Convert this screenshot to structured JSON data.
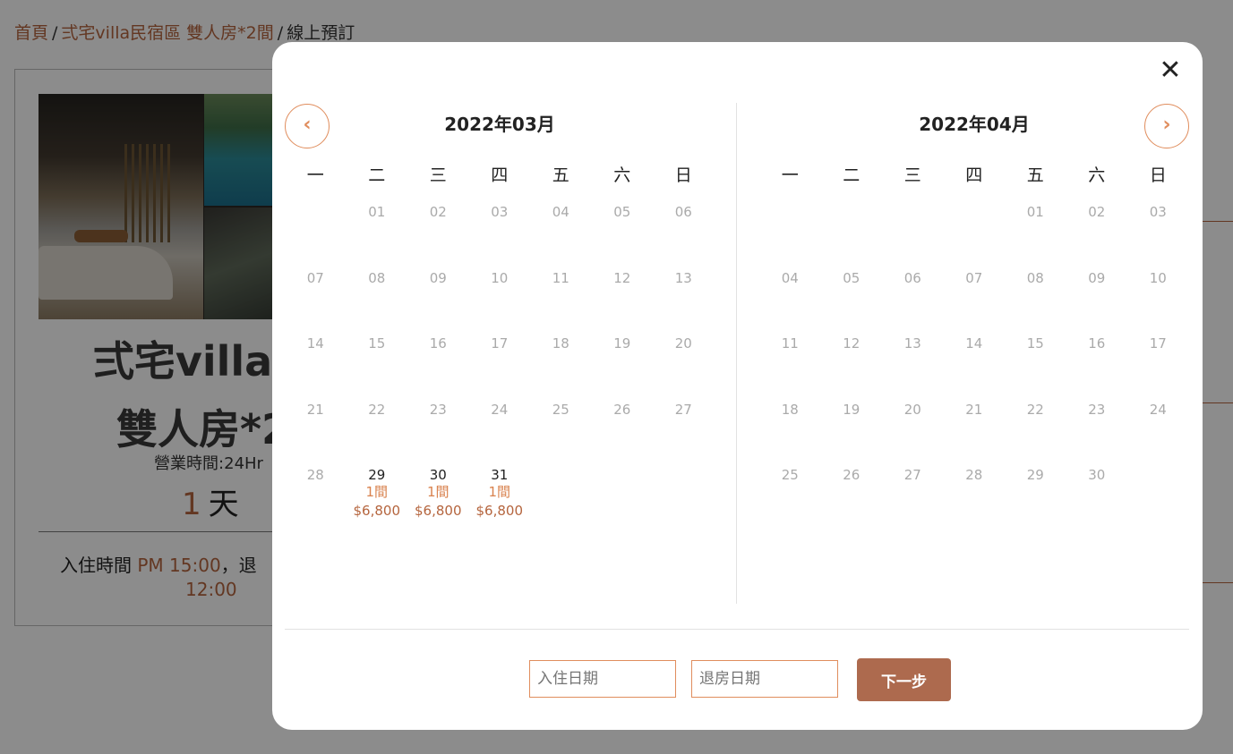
{
  "breadcrumb": {
    "home": "首頁",
    "property": "弍宅villa民宿區 雙人房*2間",
    "current": "線上預訂",
    "separator": "/"
  },
  "card": {
    "title_line1": "弍宅villa民",
    "title_line2": "雙人房*2",
    "hours": "營業時間:24Hr",
    "days_num": "1",
    "days_unit": "天",
    "checkin_label": "入住時間",
    "checkin_time": "PM 15:00",
    "checkout_partial": "，退",
    "checkout_time": "12:00"
  },
  "modal": {
    "close_glyph": "✕",
    "prev_glyph": "‹",
    "next_glyph": "›",
    "weekdays": [
      "一",
      "二",
      "三",
      "四",
      "五",
      "六",
      "日"
    ],
    "months": [
      {
        "title": "2022年03月",
        "leading_blanks": 1,
        "days": [
          {
            "d": "01"
          },
          {
            "d": "02"
          },
          {
            "d": "03"
          },
          {
            "d": "04"
          },
          {
            "d": "05"
          },
          {
            "d": "06"
          },
          {
            "d": "07"
          },
          {
            "d": "08"
          },
          {
            "d": "09"
          },
          {
            "d": "10"
          },
          {
            "d": "11"
          },
          {
            "d": "12"
          },
          {
            "d": "13"
          },
          {
            "d": "14"
          },
          {
            "d": "15"
          },
          {
            "d": "16"
          },
          {
            "d": "17"
          },
          {
            "d": "18"
          },
          {
            "d": "19"
          },
          {
            "d": "20"
          },
          {
            "d": "21"
          },
          {
            "d": "22"
          },
          {
            "d": "23"
          },
          {
            "d": "24"
          },
          {
            "d": "25"
          },
          {
            "d": "26"
          },
          {
            "d": "27"
          },
          {
            "d": "28"
          },
          {
            "d": "29",
            "rooms": "1間",
            "price": "$6,800"
          },
          {
            "d": "30",
            "rooms": "1間",
            "price": "$6,800"
          },
          {
            "d": "31",
            "rooms": "1間",
            "price": "$6,800"
          }
        ]
      },
      {
        "title": "2022年04月",
        "leading_blanks": 4,
        "days": [
          {
            "d": "01"
          },
          {
            "d": "02"
          },
          {
            "d": "03"
          },
          {
            "d": "04"
          },
          {
            "d": "05"
          },
          {
            "d": "06"
          },
          {
            "d": "07"
          },
          {
            "d": "08"
          },
          {
            "d": "09"
          },
          {
            "d": "10"
          },
          {
            "d": "11"
          },
          {
            "d": "12"
          },
          {
            "d": "13"
          },
          {
            "d": "14"
          },
          {
            "d": "15"
          },
          {
            "d": "16"
          },
          {
            "d": "17"
          },
          {
            "d": "18"
          },
          {
            "d": "19"
          },
          {
            "d": "20"
          },
          {
            "d": "21"
          },
          {
            "d": "22"
          },
          {
            "d": "23"
          },
          {
            "d": "24"
          },
          {
            "d": "25"
          },
          {
            "d": "26"
          },
          {
            "d": "27"
          },
          {
            "d": "28"
          },
          {
            "d": "29"
          },
          {
            "d": "30"
          }
        ]
      }
    ],
    "checkin_placeholder": "入住日期",
    "checkout_placeholder": "退房日期",
    "next_button": "下一步"
  },
  "colors": {
    "accent": "#e08d5d",
    "brand": "#ad6a4e",
    "price": "#b5653e"
  }
}
